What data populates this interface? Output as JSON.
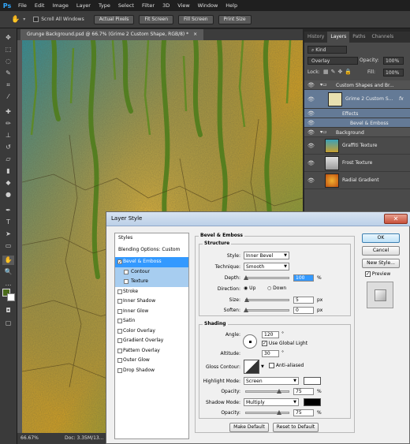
{
  "menu": {
    "logo": "Ps",
    "items": [
      "File",
      "Edit",
      "Image",
      "Layer",
      "Type",
      "Select",
      "Filter",
      "3D",
      "View",
      "Window",
      "Help"
    ]
  },
  "options": {
    "scroll_all": "Scroll All Windows",
    "buttons": [
      "Actual Pixels",
      "Fit Screen",
      "Fill Screen",
      "Print Size"
    ]
  },
  "document": {
    "tab": "Grunge Background.psd @ 66.7% (Grime 2 Custom Shape, RGB/8) *",
    "zoom": "66.67%",
    "doc": "Doc: 3.35M/13..."
  },
  "panel": {
    "tabs": [
      "History",
      "Layers",
      "Paths",
      "Channels"
    ],
    "kind": "Kind",
    "blend": "Overlay",
    "opacity_label": "Opacity:",
    "opacity": "100%",
    "lock_label": "Lock:",
    "fill_label": "Fill:",
    "fill": "100%",
    "layers": [
      "Custom Shapes and Br...",
      "Grime 2 Custom S...",
      "Effects",
      "Bevel & Emboss",
      "Background",
      "Graffiti Texture",
      "Frost Texture",
      "Radial Gradient"
    ],
    "fx": "fx"
  },
  "dialog": {
    "title": "Layer Style",
    "close": "✕",
    "styles_header": "Styles",
    "blending": "Blending Options: Custom",
    "styles": [
      "Bevel & Emboss",
      "Contour",
      "Texture",
      "Stroke",
      "Inner Shadow",
      "Inner Glow",
      "Satin",
      "Color Overlay",
      "Gradient Overlay",
      "Pattern Overlay",
      "Outer Glow",
      "Drop Shadow"
    ],
    "section": "Bevel & Emboss",
    "structure": "Structure",
    "style_label": "Style:",
    "style_value": "Inner Bevel",
    "technique_label": "Technique:",
    "technique_value": "Smooth",
    "depth_label": "Depth:",
    "depth": "100",
    "pct": "%",
    "direction_label": "Direction:",
    "up": "Up",
    "down": "Down",
    "size_label": "Size:",
    "size": "5",
    "px": "px",
    "soften_label": "Soften:",
    "soften": "0",
    "shading": "Shading",
    "angle_label": "Angle:",
    "angle": "120",
    "deg": "°",
    "global_light": "Use Global Light",
    "altitude_label": "Altitude:",
    "altitude": "30",
    "gloss_label": "Gloss Contour:",
    "anti_aliased": "Anti-aliased",
    "highlight_label": "Highlight Mode:",
    "highlight_mode": "Screen",
    "opacity_label": "Opacity:",
    "hl_opacity": "75",
    "shadow_label": "Shadow Mode:",
    "shadow_mode": "Multiply",
    "sh_opacity": "75",
    "make_default": "Make Default",
    "reset_default": "Reset to Default",
    "ok": "OK",
    "cancel": "Cancel",
    "new_style": "New Style...",
    "preview": "Preview"
  }
}
